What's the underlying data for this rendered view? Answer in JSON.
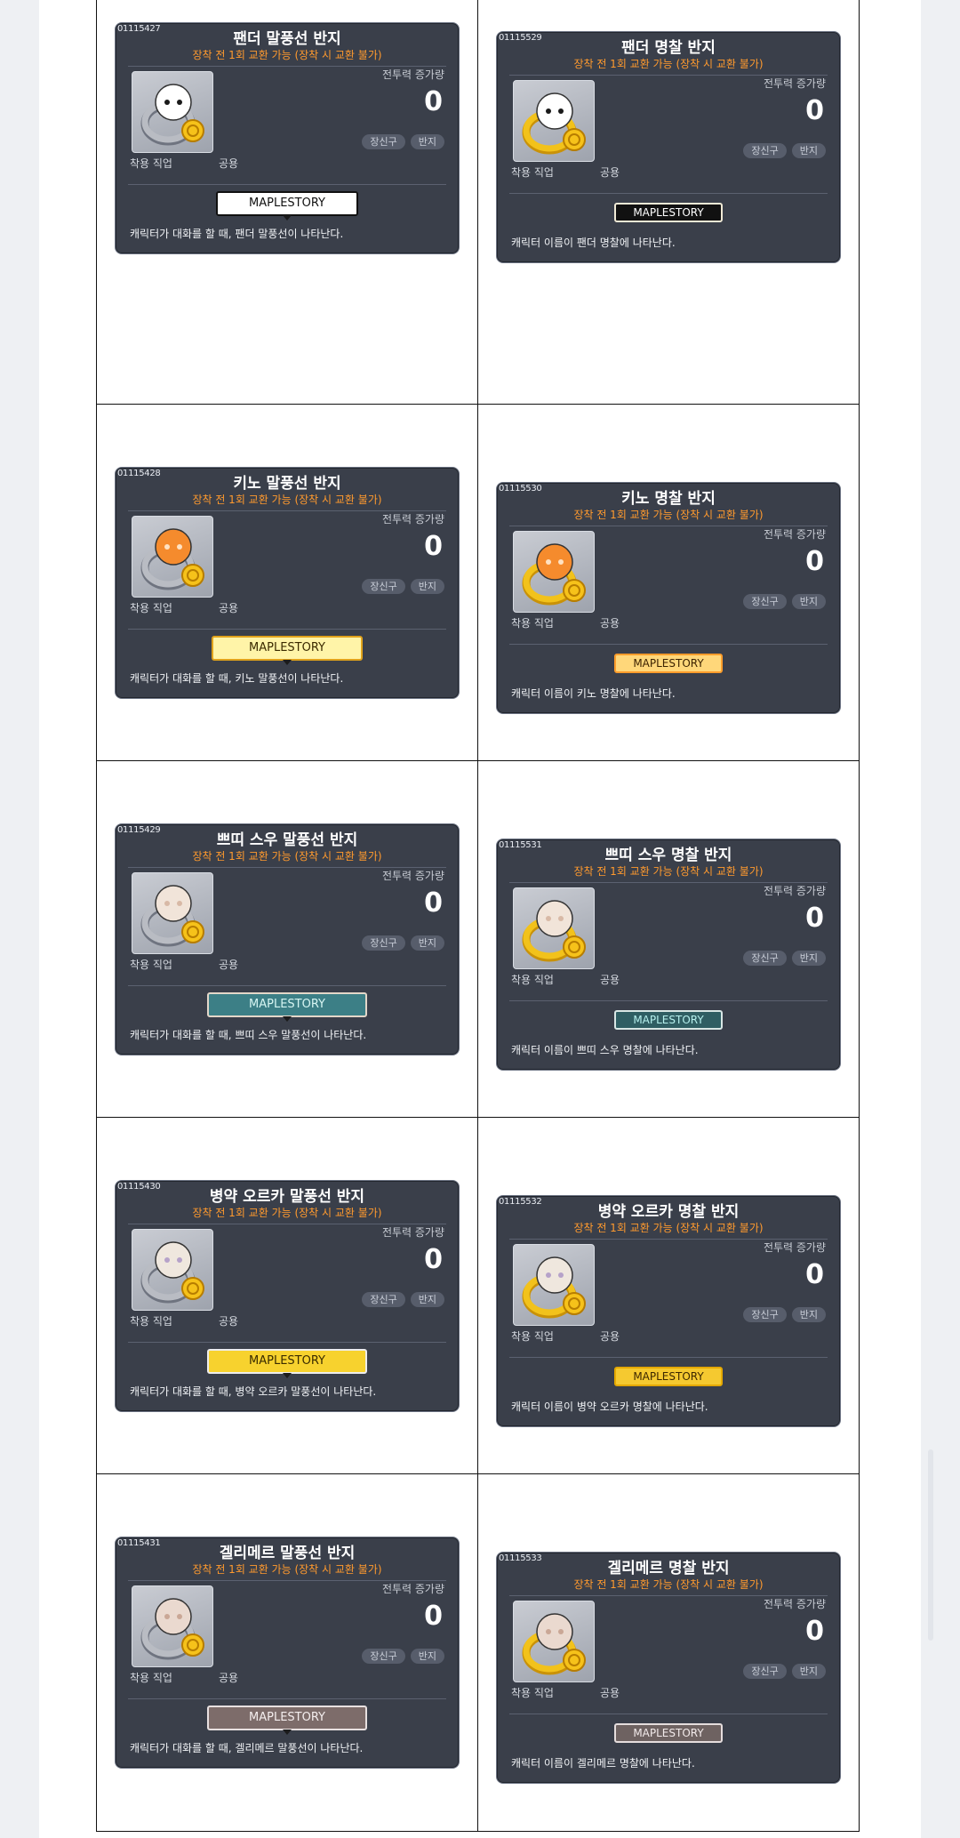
{
  "rows": [
    {
      "left": {
        "id": "01115427",
        "title": "팬더 말풍선 반지",
        "subtitle": "장착 전 1회 교환 가능 (장착 시 교환 불가)",
        "stat_label": "전투력 증가량",
        "stat_value": "0",
        "tags": [
          "장신구",
          "반지"
        ],
        "job_label": "착용 직업",
        "job_value": "공용",
        "preview_text": "MAPLESTORY",
        "description": "캐릭터가 대화를 할 때, 팬더 말풍선이 나타난다."
      },
      "right": {
        "id": "01115529",
        "title": "팬더 명찰 반지",
        "subtitle": "장착 전 1회 교환 가능 (장착 시 교환 불가)",
        "stat_label": "전투력 증가량",
        "stat_value": "0",
        "tags": [
          "장신구",
          "반지"
        ],
        "job_label": "착용 직업",
        "job_value": "공용",
        "preview_text": "MAPLESTORY",
        "description": "캐릭터 이름이 팬더 명찰에 나타난다."
      }
    },
    {
      "left": {
        "id": "01115428",
        "title": "키노 말풍선 반지",
        "subtitle": "장착 전 1회 교환 가능 (장착 시 교환 불가)",
        "stat_label": "전투력 증가량",
        "stat_value": "0",
        "tags": [
          "장신구",
          "반지"
        ],
        "job_label": "착용 직업",
        "job_value": "공용",
        "preview_text": "MAPLESTORY",
        "description": "캐릭터가 대화를 할 때, 키노 말풍선이 나타난다."
      },
      "right": {
        "id": "01115530",
        "title": "키노 명찰 반지",
        "subtitle": "장착 전 1회 교환 가능 (장착 시 교환 불가)",
        "stat_label": "전투력 증가량",
        "stat_value": "0",
        "tags": [
          "장신구",
          "반지"
        ],
        "job_label": "착용 직업",
        "job_value": "공용",
        "preview_text": "MAPLESTORY",
        "description": "캐릭터 이름이 키노 명찰에 나타난다."
      }
    },
    {
      "left": {
        "id": "01115429",
        "title": "쁘띠 스우 말풍선 반지",
        "subtitle": "장착 전 1회 교환 가능 (장착 시 교환 불가)",
        "stat_label": "전투력 증가량",
        "stat_value": "0",
        "tags": [
          "장신구",
          "반지"
        ],
        "job_label": "착용 직업",
        "job_value": "공용",
        "preview_text": "MAPLESTORY",
        "description": "캐릭터가 대화를 할 때, 쁘띠 스우 말풍선이 나타난다."
      },
      "right": {
        "id": "01115531",
        "title": "쁘띠 스우 명찰 반지",
        "subtitle": "장착 전 1회 교환 가능 (장착 시 교환 불가)",
        "stat_label": "전투력 증가량",
        "stat_value": "0",
        "tags": [
          "장신구",
          "반지"
        ],
        "job_label": "착용 직업",
        "job_value": "공용",
        "preview_text": "MAPLESTORY",
        "description": "캐릭터 이름이 쁘띠 스우 명찰에 나타난다."
      }
    },
    {
      "left": {
        "id": "01115430",
        "title": "병약 오르카 말풍선 반지",
        "subtitle": "장착 전 1회 교환 가능 (장착 시 교환 불가)",
        "stat_label": "전투력 증가량",
        "stat_value": "0",
        "tags": [
          "장신구",
          "반지"
        ],
        "job_label": "착용 직업",
        "job_value": "공용",
        "preview_text": "MAPLESTORY",
        "description": "캐릭터가 대화를 할 때, 병약 오르카 말풍선이 나타난다."
      },
      "right": {
        "id": "01115532",
        "title": "병약 오르카 명찰 반지",
        "subtitle": "장착 전 1회 교환 가능 (장착 시 교환 불가)",
        "stat_label": "전투력 증가량",
        "stat_value": "0",
        "tags": [
          "장신구",
          "반지"
        ],
        "job_label": "착용 직업",
        "job_value": "공용",
        "preview_text": "MAPLESTORY",
        "description": "캐릭터 이름이 병약 오르카 명찰에 나타난다."
      }
    },
    {
      "left": {
        "id": "01115431",
        "title": "겔리메르 말풍선 반지",
        "subtitle": "장착 전 1회 교환 가능 (장착 시 교환 불가)",
        "stat_label": "전투력 증가량",
        "stat_value": "0",
        "tags": [
          "장신구",
          "반지"
        ],
        "job_label": "착용 직업",
        "job_value": "공용",
        "preview_text": "MAPLESTORY",
        "description": "캐릭터가 대화를 할 때, 겔리메르 말풍선이 나타난다."
      },
      "right": {
        "id": "01115533",
        "title": "겔리메르 명찰 반지",
        "subtitle": "장착 전 1회 교환 가능 (장착 시 교환 불가)",
        "stat_label": "전투력 증가량",
        "stat_value": "0",
        "tags": [
          "장신구",
          "반지"
        ],
        "job_label": "착용 직업",
        "job_value": "공용",
        "preview_text": "MAPLESTORY",
        "description": "캐릭터 이름이 겔리메르 명찰에 나타난다."
      }
    }
  ],
  "colors": {
    "card_bg": "#3a3f4a",
    "subtitle": "#ff9a2e",
    "ring_gold": "#f2c21b",
    "ring_silver": "#b9bcc3"
  }
}
